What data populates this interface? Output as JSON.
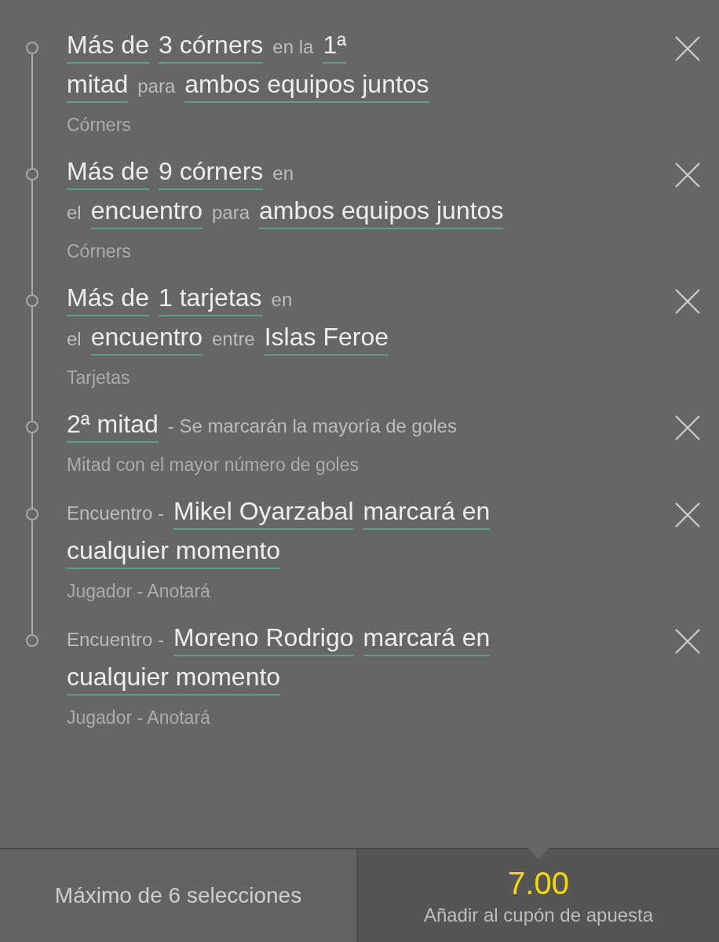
{
  "selections": [
    {
      "lines": [
        [
          {
            "kind": "link",
            "text": "Más de"
          },
          {
            "kind": "link",
            "text": "3 córners"
          },
          {
            "kind": "plain",
            "text": "en la"
          },
          {
            "kind": "link",
            "text": "1ª"
          }
        ],
        [
          {
            "kind": "link",
            "text": "mitad"
          },
          {
            "kind": "plain",
            "text": "para"
          },
          {
            "kind": "link",
            "text": "ambos equipos juntos"
          }
        ]
      ],
      "category": "Córners"
    },
    {
      "lines": [
        [
          {
            "kind": "link",
            "text": "Más de"
          },
          {
            "kind": "link",
            "text": "9 córners"
          },
          {
            "kind": "plain",
            "text": "en"
          }
        ],
        [
          {
            "kind": "plain",
            "text": "el"
          },
          {
            "kind": "link",
            "text": "encuentro"
          },
          {
            "kind": "plain",
            "text": "para"
          },
          {
            "kind": "link",
            "text": "ambos equipos juntos"
          }
        ]
      ],
      "category": "Córners"
    },
    {
      "lines": [
        [
          {
            "kind": "link",
            "text": "Más de"
          },
          {
            "kind": "link",
            "text": "1 tarjetas"
          },
          {
            "kind": "plain",
            "text": "en"
          }
        ],
        [
          {
            "kind": "plain",
            "text": "el"
          },
          {
            "kind": "link",
            "text": "encuentro"
          },
          {
            "kind": "plain",
            "text": "entre"
          },
          {
            "kind": "link",
            "text": "Islas Feroe"
          }
        ]
      ],
      "category": "Tarjetas"
    },
    {
      "lines": [
        [
          {
            "kind": "link",
            "text": "2ª mitad"
          },
          {
            "kind": "plain",
            "text": "- Se marcarán la mayoría de goles"
          }
        ]
      ],
      "category": "Mitad con el mayor número de goles"
    },
    {
      "lines": [
        [
          {
            "kind": "plain",
            "text": "Encuentro -"
          },
          {
            "kind": "link",
            "text": "Mikel Oyarzabal"
          },
          {
            "kind": "link",
            "text": "marcará en"
          }
        ],
        [
          {
            "kind": "link",
            "text": "cualquier momento"
          }
        ]
      ],
      "category": "Jugador - Anotará"
    },
    {
      "lines": [
        [
          {
            "kind": "plain",
            "text": "Encuentro -"
          },
          {
            "kind": "link",
            "text": "Moreno Rodrigo"
          },
          {
            "kind": "link",
            "text": "marcará en"
          }
        ],
        [
          {
            "kind": "link",
            "text": "cualquier momento"
          }
        ]
      ],
      "category": "Jugador - Anotará"
    }
  ],
  "footer": {
    "limit_text": "Máximo de 6 selecciones",
    "odds": "7.00",
    "add_label": "Añadir al cupón de apuesta"
  }
}
